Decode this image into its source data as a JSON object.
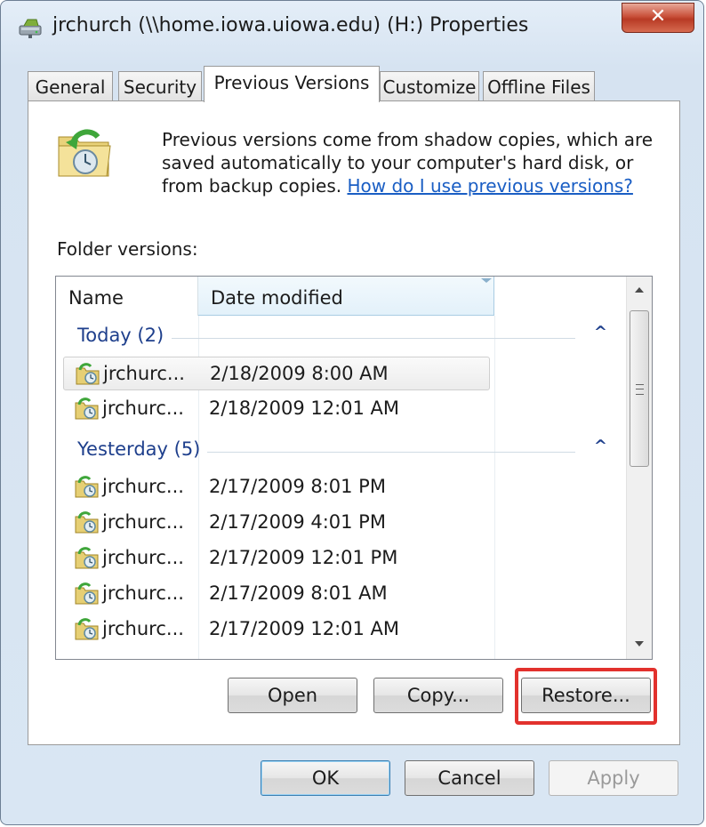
{
  "window": {
    "title": "jrchurch (\\\\home.iowa.uiowa.edu) (H:) Properties",
    "close_label": "✕"
  },
  "tabs": [
    {
      "label": "General"
    },
    {
      "label": "Security"
    },
    {
      "label": "Previous Versions",
      "active": true
    },
    {
      "label": "Customize"
    },
    {
      "label": "Offline Files"
    }
  ],
  "intro": {
    "text": "Previous versions come from shadow copies, which are saved automatically to your computer's hard disk, or from backup copies. ",
    "link": "How do I use previous versions?"
  },
  "folder_versions_label": "Folder versions:",
  "list": {
    "columns": [
      "Name",
      "Date modified"
    ],
    "groups": [
      {
        "label": "Today (2)",
        "items": [
          {
            "name": "jrchurc...",
            "date": "2/18/2009 8:00 AM",
            "selected": true
          },
          {
            "name": "jrchurc...",
            "date": "2/18/2009 12:01 AM"
          }
        ]
      },
      {
        "label": "Yesterday (5)",
        "items": [
          {
            "name": "jrchurc...",
            "date": "2/17/2009 8:01 PM"
          },
          {
            "name": "jrchurc...",
            "date": "2/17/2009 4:01 PM"
          },
          {
            "name": "jrchurc...",
            "date": "2/17/2009 12:01 PM"
          },
          {
            "name": "jrchurc...",
            "date": "2/17/2009 8:01 AM"
          },
          {
            "name": "jrchurc...",
            "date": "2/17/2009 12:01 AM"
          }
        ]
      }
    ]
  },
  "actions": {
    "open": "Open",
    "copy": "Copy...",
    "restore": "Restore..."
  },
  "dialog_buttons": {
    "ok": "OK",
    "cancel": "Cancel",
    "apply": "Apply"
  },
  "colors": {
    "highlight": "#e2312d",
    "link": "#1a5ec4",
    "group_text": "#1e3f8c"
  }
}
